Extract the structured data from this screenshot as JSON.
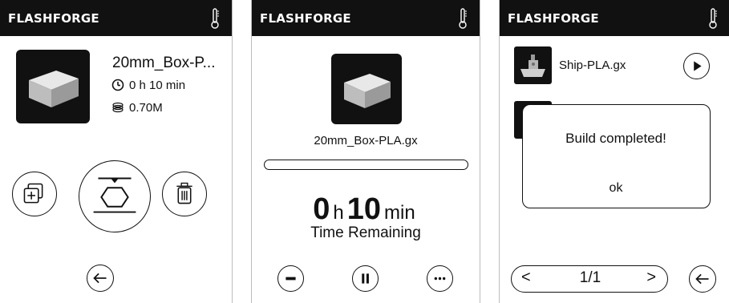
{
  "screens": [
    {
      "brand": "FLASHFORGE",
      "file": {
        "name": "20mm_Box-P...",
        "time": "0 h 10 min",
        "filament": "0.70M"
      }
    },
    {
      "brand": "FLASHFORGE",
      "file_name": "20mm_Box-PLA.gx",
      "progress": 0.0,
      "time_remaining": {
        "hours": "0",
        "hours_unit": "h",
        "minutes": "10",
        "minutes_unit": "min",
        "label": "Time Remaining"
      }
    },
    {
      "brand": "FLASHFORGE",
      "files": [
        "Ship-PLA.gx"
      ],
      "dialog": {
        "message": "Build completed!",
        "ok_label": "ok"
      },
      "pager": {
        "prev": "<",
        "page": "1/1",
        "next": ">"
      }
    }
  ],
  "colors": {
    "header": "#111111",
    "foreground": "#111111",
    "background": "#ffffff"
  }
}
